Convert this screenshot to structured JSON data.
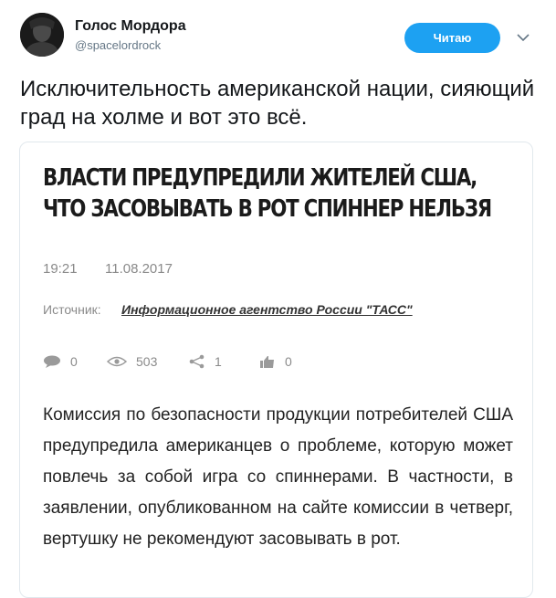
{
  "user": {
    "name": "Голос Мордора",
    "handle": "@spacelordrock"
  },
  "follow_button": {
    "label": "Читаю"
  },
  "tweet": {
    "text": "Исключительность американской нации, сияющий град на холме и вот это всё."
  },
  "article": {
    "headline_line1": "ВЛАСТИ ПРЕДУПРЕДИЛИ ЖИТЕЛЕЙ США,",
    "headline_line2": "ЧТО ЗАСОВЫВАТЬ В РОТ СПИННЕР НЕЛЬЗЯ",
    "time": "19:21",
    "date": "11.08.2017",
    "source_label": "Источник:",
    "source_name": "Информационное агентство России \"ТАСС\"",
    "stats": {
      "comments": "0",
      "views": "503",
      "shares": "1",
      "likes": "0"
    },
    "body": "Комиссия по безопасности продукции потребителей США предупредила американцев о проблеме, которую может повлечь за собой игра со спиннерами. В частности, в заявлении, опубликованном на сайте комиссии в четверг, вертушку не рекомендуют засовывать в рот."
  },
  "icons": {
    "comment": "speech-bubble-icon",
    "views": "eye-icon",
    "share": "share-icon",
    "like": "thumbs-up-icon",
    "more": "chevron-down-icon"
  },
  "colors": {
    "accent": "#1da1f2",
    "muted": "#8a8a8a",
    "text": "#14171a"
  }
}
